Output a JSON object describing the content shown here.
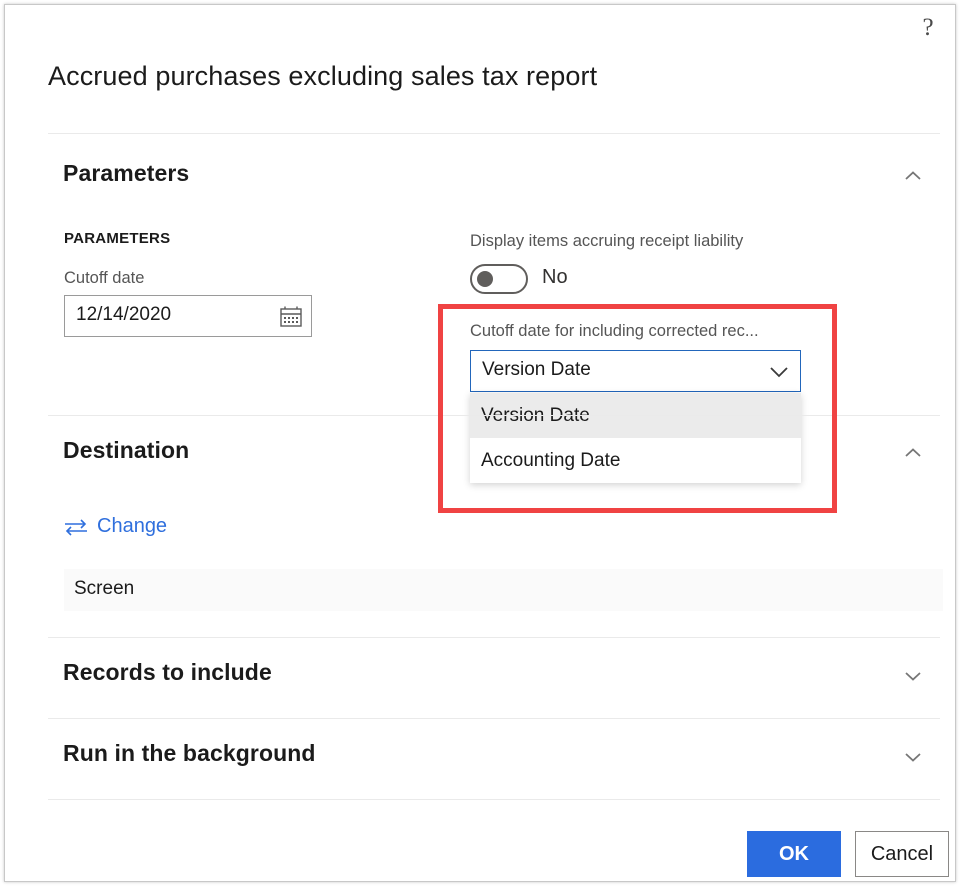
{
  "dialog": {
    "title": "Accrued purchases excluding sales tax report",
    "help_icon_label": "?"
  },
  "sections": {
    "parameters": {
      "title": "Parameters",
      "group_label": "PARAMETERS",
      "cutoff_date": {
        "label": "Cutoff date",
        "value": "12/14/2020"
      },
      "display_items": {
        "label": "Display items accruing receipt liability",
        "value": "No"
      },
      "corrected_receipts": {
        "label": "Cutoff date for including corrected rec...",
        "selected": "Version Date",
        "options": [
          "Version Date",
          "Accounting Date"
        ]
      }
    },
    "destination": {
      "title": "Destination",
      "change_label": "Change",
      "value": "Screen"
    },
    "records_to_include": {
      "title": "Records to include"
    },
    "run_in_background": {
      "title": "Run in the background"
    }
  },
  "footer": {
    "ok_label": "OK",
    "cancel_label": "Cancel"
  },
  "colors": {
    "primary_button": "#2b6cdf",
    "link": "#2f6fdd",
    "highlight_box": "#f04343",
    "combo_focus_border": "#2266bb",
    "option_selected_bg": "#ebebeb"
  }
}
